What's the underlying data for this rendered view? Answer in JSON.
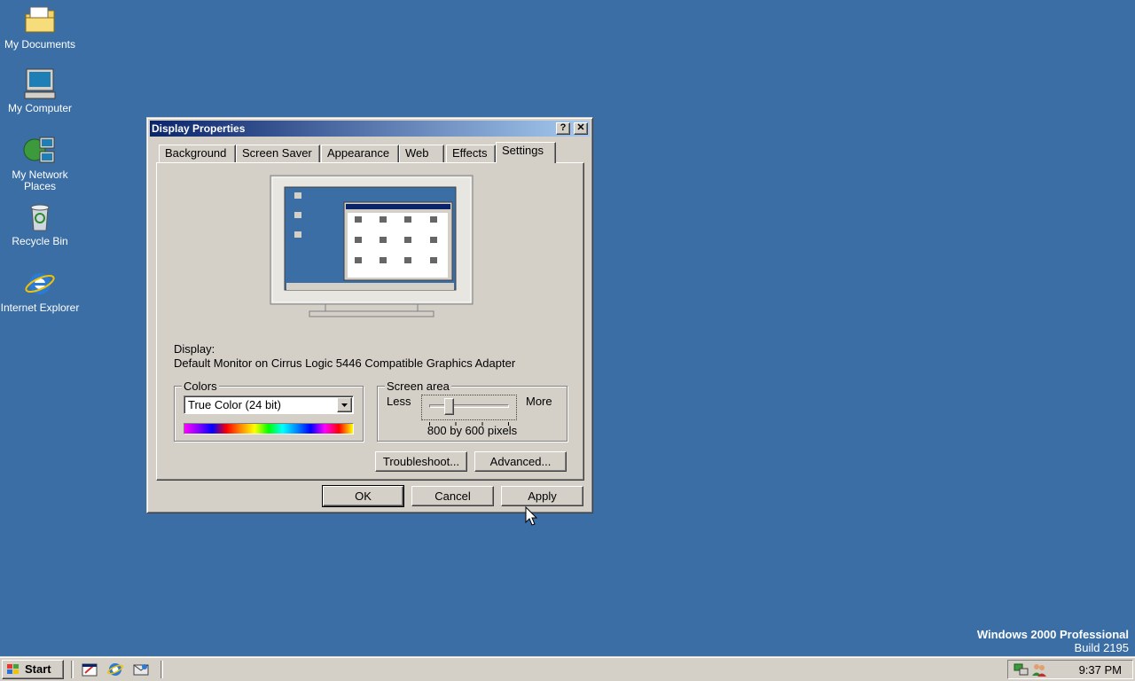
{
  "desktop": {
    "icons": [
      {
        "label": "My Documents"
      },
      {
        "label": "My Computer"
      },
      {
        "label": "My Network Places"
      },
      {
        "label": "Recycle Bin"
      },
      {
        "label": "Internet Explorer"
      }
    ],
    "watermark": {
      "line1": "Windows 2000 Professional",
      "line2": "Build 2195"
    }
  },
  "dialog": {
    "title": "Display Properties",
    "help_btn": "?",
    "close_btn": "✕",
    "tabs": [
      "Background",
      "Screen Saver",
      "Appearance",
      "Web",
      "Effects",
      "Settings"
    ],
    "active_tab": "Settings",
    "display_label": "Display:",
    "display_value": "Default Monitor on Cirrus Logic 5446 Compatible Graphics Adapter",
    "colors": {
      "group_label": "Colors",
      "selected": "True Color (24 bit)"
    },
    "screen_area": {
      "group_label": "Screen area",
      "less": "Less",
      "more": "More",
      "resolution": "800 by 600 pixels",
      "slider_level": 0.25
    },
    "troubleshoot_btn": "Troubleshoot...",
    "advanced_btn": "Advanced...",
    "ok_btn": "OK",
    "cancel_btn": "Cancel",
    "apply_btn": "Apply"
  },
  "taskbar": {
    "start_label": "Start",
    "clock": "9:37 PM"
  },
  "colors": {
    "desktop": "#3a6ea5",
    "face": "#d4d0c8",
    "titlebar_start": "#0a246a",
    "titlebar_end": "#a6caf0"
  }
}
